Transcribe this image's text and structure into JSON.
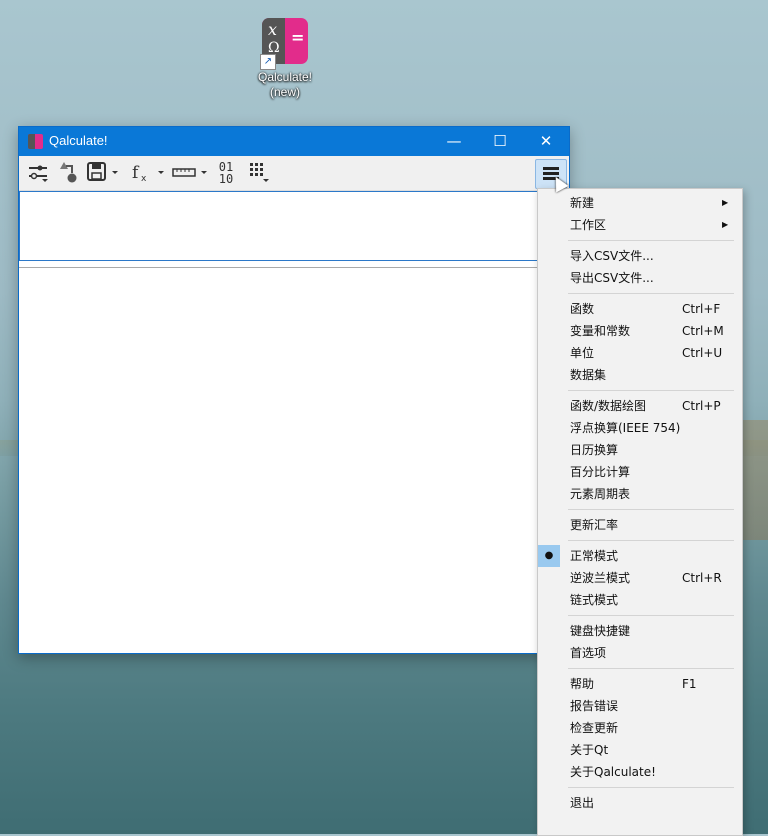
{
  "desktop": {
    "icon_label_line1": "Qalculate!",
    "icon_label_line2": "(new)"
  },
  "window": {
    "title": "Qalculate!",
    "controls": {
      "minimize": "—",
      "maximize": "☐",
      "close": "✕"
    }
  },
  "toolbar": {
    "binary_top": "01",
    "binary_bottom": "10"
  },
  "menu": {
    "items": [
      {
        "label": "新建",
        "shortcut": "",
        "submenu": true
      },
      {
        "label": "工作区",
        "shortcut": "",
        "submenu": true
      },
      {
        "label": "导入CSV文件...",
        "shortcut": ""
      },
      {
        "label": "导出CSV文件...",
        "shortcut": ""
      },
      {
        "label": "函数",
        "shortcut": "Ctrl+F"
      },
      {
        "label": "变量和常数",
        "shortcut": "Ctrl+M"
      },
      {
        "label": "单位",
        "shortcut": "Ctrl+U"
      },
      {
        "label": "数据集",
        "shortcut": ""
      },
      {
        "label": "函数/数据绘图",
        "shortcut": "Ctrl+P"
      },
      {
        "label": "浮点换算(IEEE 754)",
        "shortcut": ""
      },
      {
        "label": "日历换算",
        "shortcut": ""
      },
      {
        "label": "百分比计算",
        "shortcut": ""
      },
      {
        "label": "元素周期表",
        "shortcut": ""
      },
      {
        "label": "更新汇率",
        "shortcut": ""
      },
      {
        "label": "正常模式",
        "shortcut": "",
        "checked": true
      },
      {
        "label": "逆波兰模式",
        "shortcut": "Ctrl+R"
      },
      {
        "label": "链式模式",
        "shortcut": ""
      },
      {
        "label": "键盘快捷键",
        "shortcut": ""
      },
      {
        "label": "首选项",
        "shortcut": ""
      },
      {
        "label": "帮助",
        "shortcut": "F1"
      },
      {
        "label": "报告错误",
        "shortcut": ""
      },
      {
        "label": "检查更新",
        "shortcut": ""
      },
      {
        "label": "关于Qt",
        "shortcut": ""
      },
      {
        "label": "关于Qalculate!",
        "shortcut": ""
      },
      {
        "label": "退出",
        "shortcut": ""
      }
    ]
  }
}
